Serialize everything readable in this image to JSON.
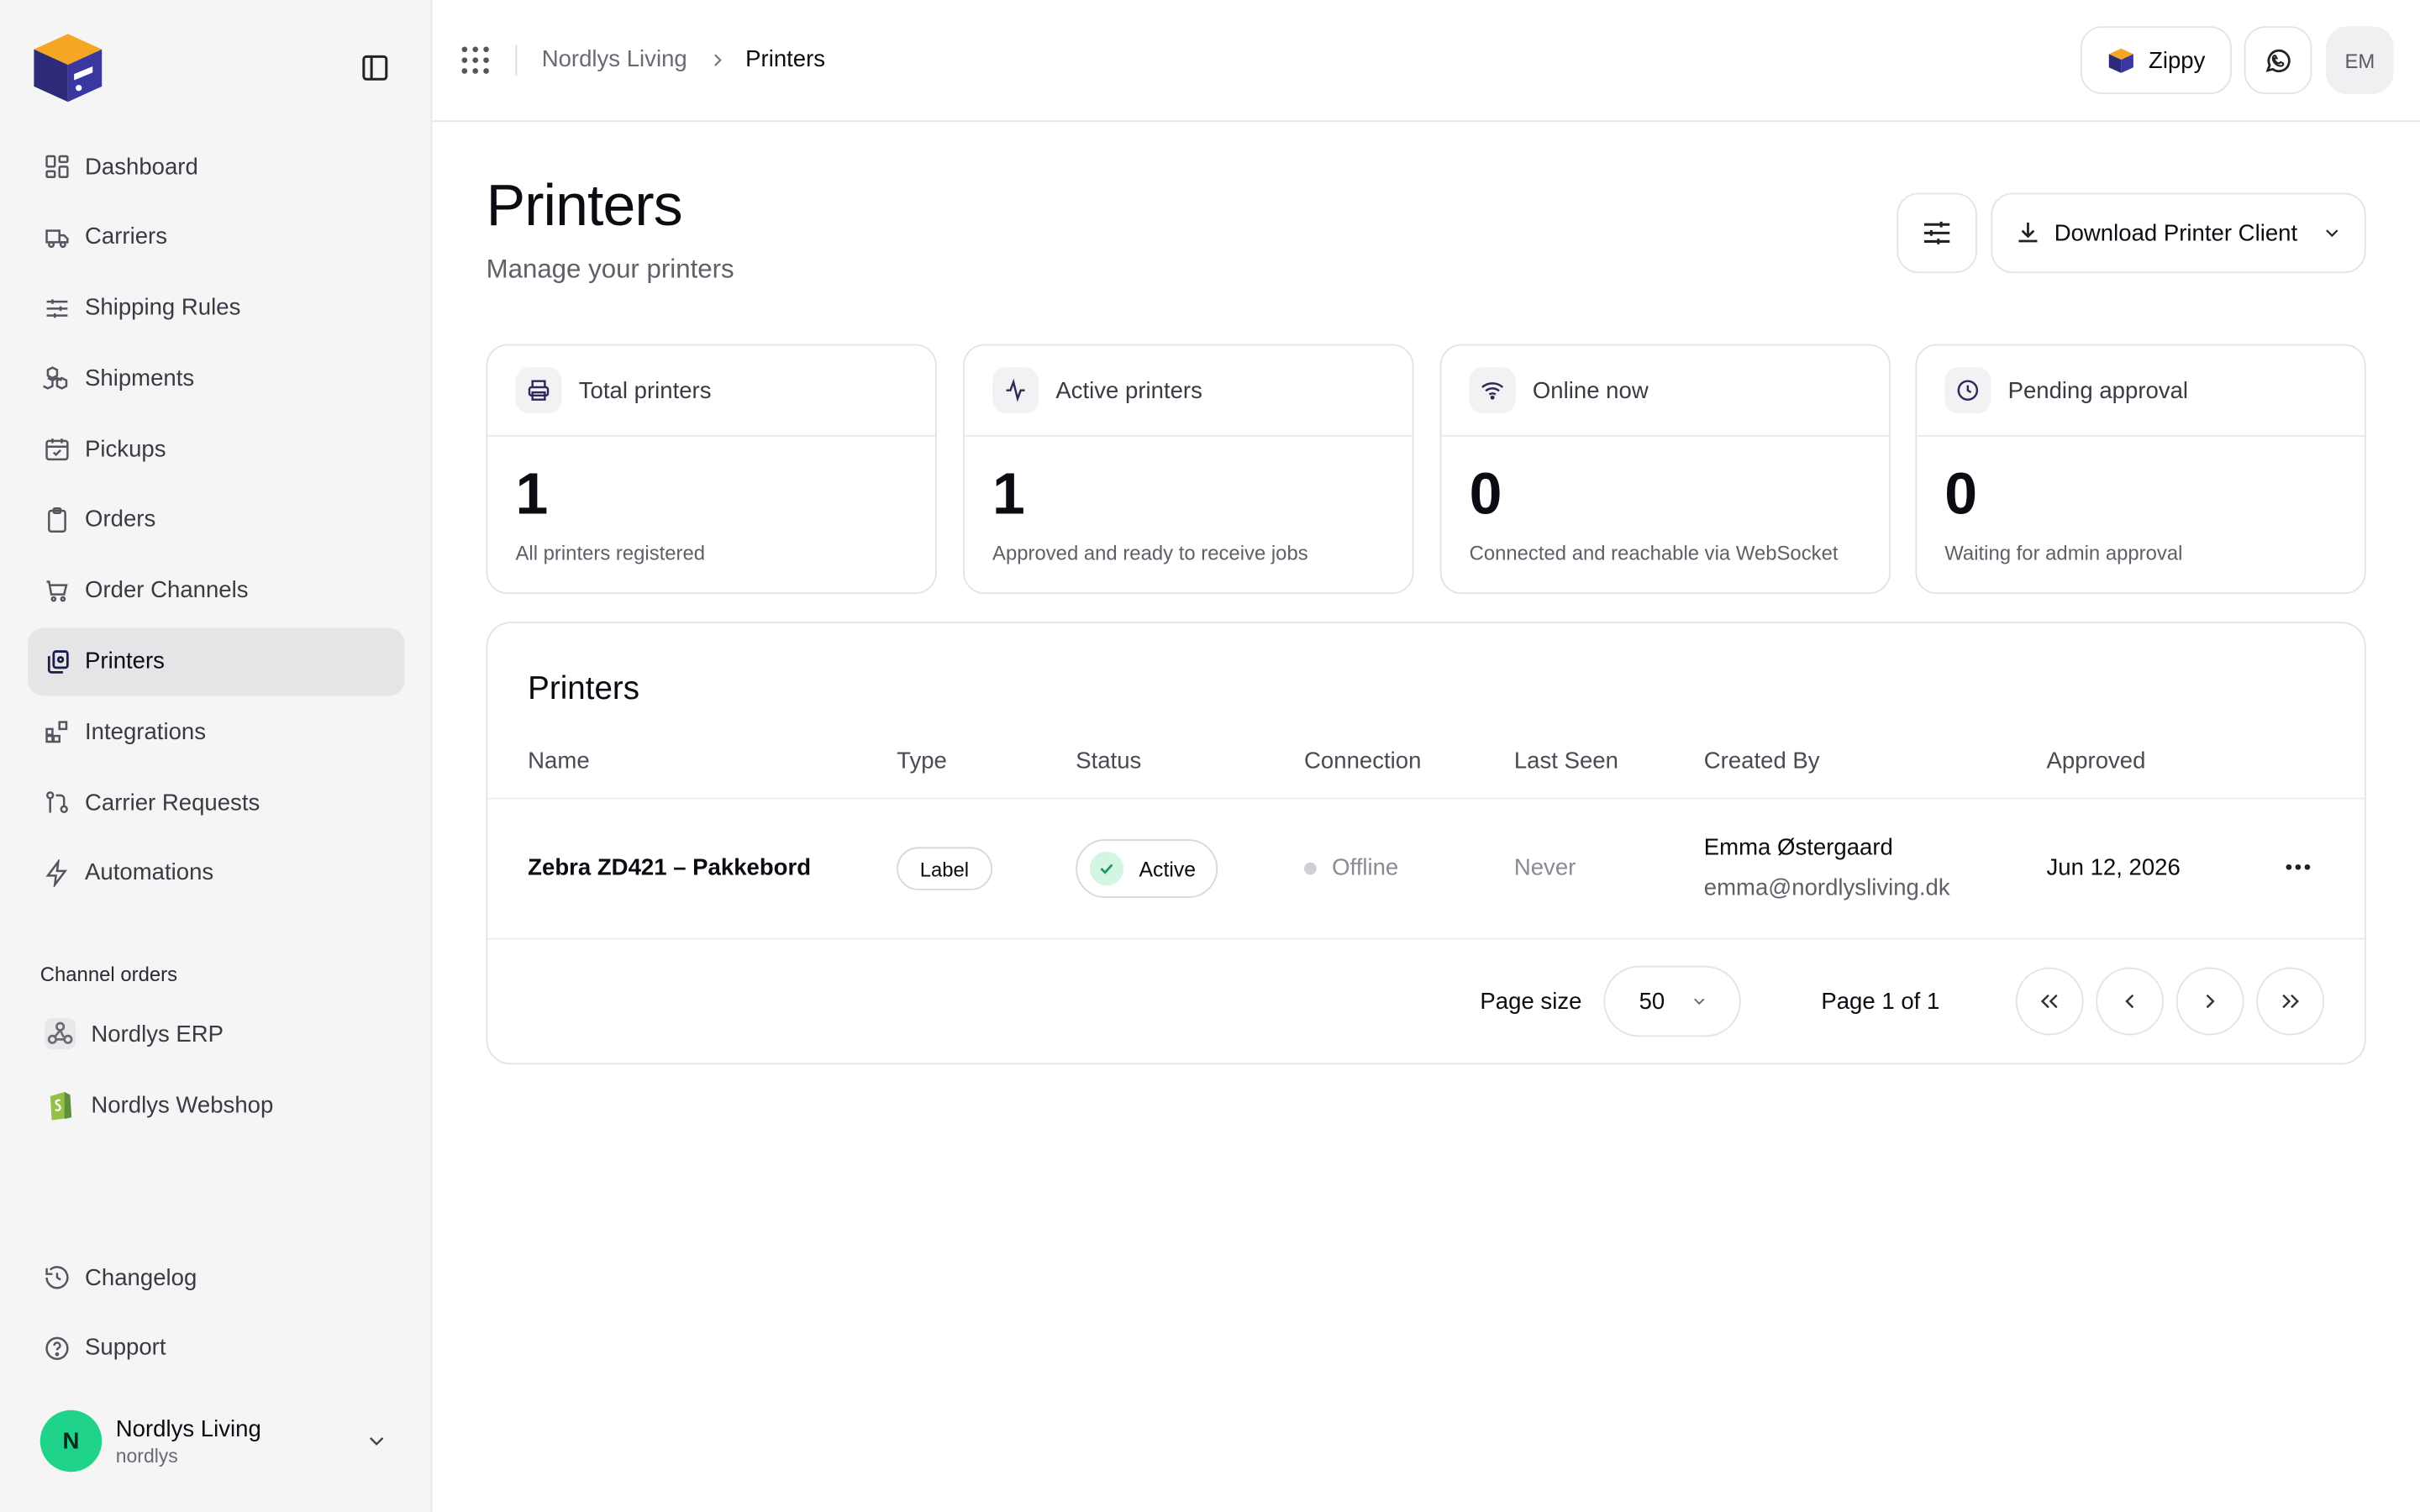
{
  "sidebar": {
    "items": [
      {
        "label": "Dashboard",
        "icon": "dashboard-icon"
      },
      {
        "label": "Carriers",
        "icon": "truck-icon"
      },
      {
        "label": "Shipping Rules",
        "icon": "sliders-icon"
      },
      {
        "label": "Shipments",
        "icon": "boxes-icon"
      },
      {
        "label": "Pickups",
        "icon": "calendar-check-icon"
      },
      {
        "label": "Orders",
        "icon": "clipboard-icon"
      },
      {
        "label": "Order Channels",
        "icon": "cart-icon"
      },
      {
        "label": "Printers",
        "icon": "printer-icon",
        "active": true
      },
      {
        "label": "Integrations",
        "icon": "blocks-icon"
      },
      {
        "label": "Carrier Requests",
        "icon": "git-pull-icon"
      },
      {
        "label": "Automations",
        "icon": "zap-icon"
      }
    ],
    "section_label": "Channel orders",
    "channels": [
      {
        "label": "Nordlys ERP",
        "icon": "webhook-icon"
      },
      {
        "label": "Nordlys Webshop",
        "icon": "shopify-icon"
      }
    ],
    "bottom": [
      {
        "label": "Changelog",
        "icon": "history-icon"
      },
      {
        "label": "Support",
        "icon": "help-circle-icon"
      }
    ],
    "account": {
      "initial": "N",
      "name": "Nordlys Living",
      "handle": "nordlys"
    }
  },
  "topbar": {
    "breadcrumb": [
      "Nordlys Living",
      "Printers"
    ],
    "zippy_label": "Zippy",
    "user_initials": "EM"
  },
  "page": {
    "title": "Printers",
    "subtitle": "Manage your printers",
    "download_label": "Download Printer Client"
  },
  "stats": [
    {
      "title": "Total printers",
      "value": "1",
      "desc": "All printers registered",
      "icon": "printer-icon"
    },
    {
      "title": "Active printers",
      "value": "1",
      "desc": "Approved and ready to receive jobs",
      "icon": "activity-icon"
    },
    {
      "title": "Online now",
      "value": "0",
      "desc": "Connected and reachable via WebSocket",
      "icon": "wifi-icon"
    },
    {
      "title": "Pending approval",
      "value": "0",
      "desc": "Waiting for admin approval",
      "icon": "clock-icon"
    }
  ],
  "table": {
    "title": "Printers",
    "columns": [
      "Name",
      "Type",
      "Status",
      "Connection",
      "Last Seen",
      "Created By",
      "Approved"
    ],
    "rows": [
      {
        "name": "Zebra ZD421 – Pakkebord",
        "type": "Label",
        "status": "Active",
        "connection": "Offline",
        "last_seen": "Never",
        "created_by_name": "Emma Østergaard",
        "created_by_email": "emma@nordlysliving.dk",
        "approved": "Jun 12, 2026"
      }
    ],
    "page_size_label": "Page size",
    "page_size": "50",
    "page_info": "Page 1 of 1"
  },
  "colors": {
    "accent_green": "#1fd38a",
    "brand_navy": "#2d2a7a",
    "brand_orange": "#f5a623"
  }
}
